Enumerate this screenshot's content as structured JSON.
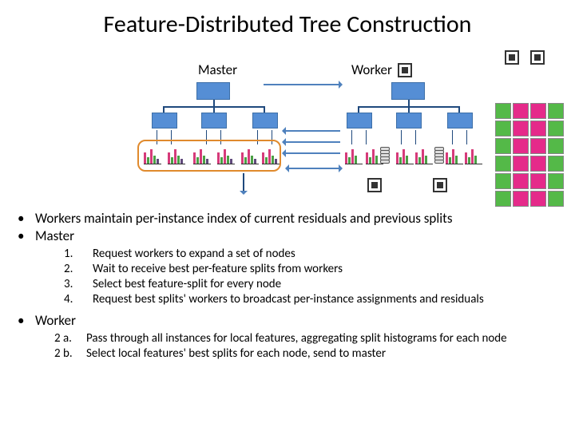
{
  "title": "Feature-Distributed Tree Construction",
  "labels": {
    "master": "Master",
    "worker": "Worker"
  },
  "bullets": {
    "b1": "Workers maintain per-instance index of current residuals and previous splits",
    "b2": "Master",
    "b3": "Worker"
  },
  "masterSteps": {
    "n1": "1.",
    "t1": "Request workers to expand a set of nodes",
    "n2": "2.",
    "t2": "Wait to receive best per-feature splits from workers",
    "n3": "3.",
    "t3": "Select best feature-split for every node",
    "n4": "4.",
    "t4": "Request best splits' workers to broadcast per-instance assignments and residuals"
  },
  "workerSteps": {
    "n1": "2 a.",
    "t1": "Pass through all instances for local features, aggregating split histograms for each node",
    "n2": "2 b.",
    "t2": "Select local features' best splits for each node, send to master"
  }
}
